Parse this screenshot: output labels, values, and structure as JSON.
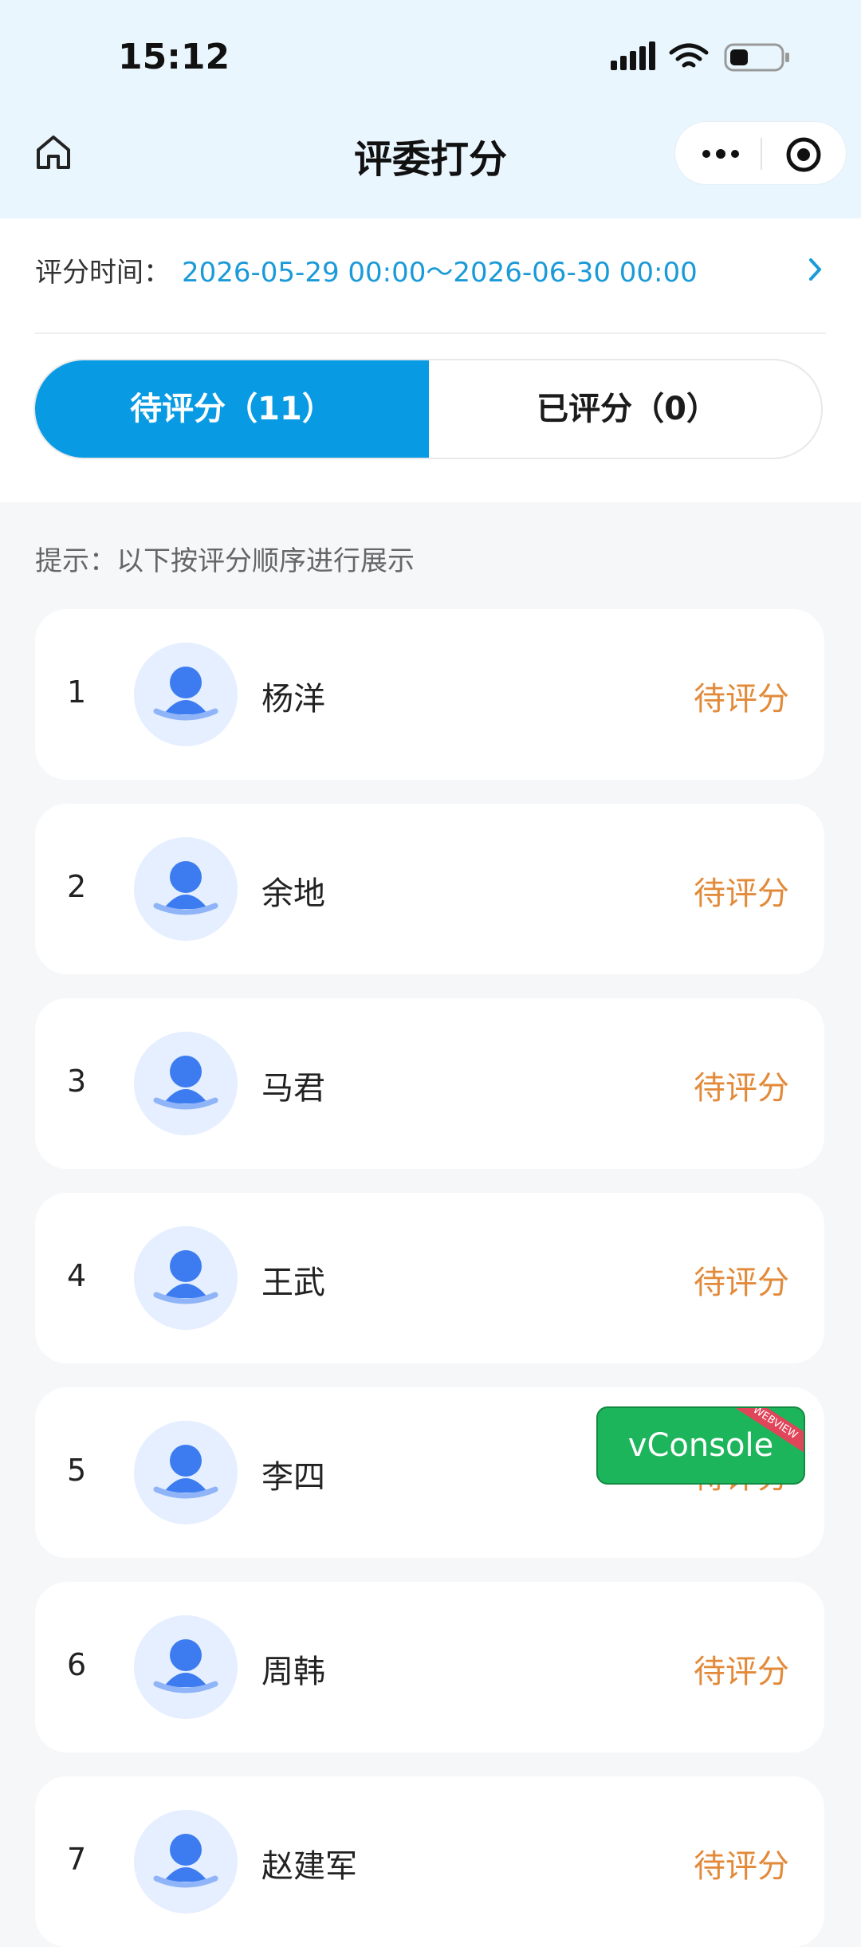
{
  "status_bar": {
    "time": "15:12"
  },
  "nav": {
    "title": "评委打分",
    "home_icon": "home-icon",
    "more_icon": "more-dots-icon",
    "target_icon": "target-circle-icon"
  },
  "filter": {
    "time_label": "评分时间：",
    "time_range": "2026-05-29 00:00～2026-06-30 00:00",
    "tabs": [
      {
        "label": "待评分（11）",
        "active": true
      },
      {
        "label": "已评分（0）",
        "active": false
      }
    ]
  },
  "hint": "提示：以下按评分顺序进行展示",
  "colors": {
    "accent": "#089be3",
    "link": "#1a9ad8",
    "pending": "#e28a3a",
    "header_bg": "#e9f6fe",
    "vconsole": "#1db55b"
  },
  "items": [
    {
      "index": "1",
      "name": "杨洋",
      "status": "待评分"
    },
    {
      "index": "2",
      "name": "余地",
      "status": "待评分"
    },
    {
      "index": "3",
      "name": "马君",
      "status": "待评分"
    },
    {
      "index": "4",
      "name": "王武",
      "status": "待评分"
    },
    {
      "index": "5",
      "name": "李四",
      "status": "待评分"
    },
    {
      "index": "6",
      "name": "周韩",
      "status": "待评分"
    },
    {
      "index": "7",
      "name": "赵建军",
      "status": "待评分"
    }
  ],
  "vconsole": {
    "label": "vConsole",
    "ribbon": "WEBVIEW"
  }
}
